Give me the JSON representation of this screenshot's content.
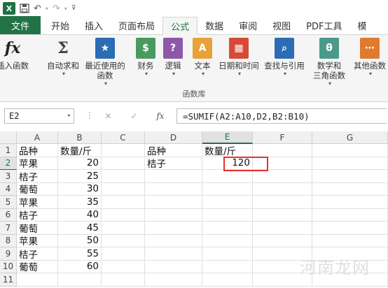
{
  "app": {
    "logo_text": "X",
    "logo_color": "#1e7145",
    "accent": "#217346"
  },
  "tabs": [
    {
      "label": "文件",
      "kind": "file"
    },
    {
      "label": "开始",
      "kind": "normal"
    },
    {
      "label": "插入",
      "kind": "normal"
    },
    {
      "label": "页面布局",
      "kind": "normal"
    },
    {
      "label": "公式",
      "kind": "active"
    },
    {
      "label": "数据",
      "kind": "normal"
    },
    {
      "label": "审阅",
      "kind": "normal"
    },
    {
      "label": "视图",
      "kind": "normal"
    },
    {
      "label": "PDF工具",
      "kind": "normal"
    },
    {
      "label": "模",
      "kind": "normal"
    }
  ],
  "ribbon": {
    "buttons": [
      {
        "name": "insert-function",
        "line1": "插入函数",
        "line2": "",
        "icon_text": "fx",
        "icon_color": "#f5f5f5",
        "icon_fg": "#222"
      },
      {
        "name": "autosum",
        "line1": "自动求和",
        "line2": "",
        "icon_text": "Σ",
        "icon_color": "#f5f5f5",
        "icon_fg": "#444"
      },
      {
        "name": "recent-functions",
        "line1": "最近使用的",
        "line2": "函数",
        "icon_text": "★",
        "icon_color": "#2b6cb5",
        "icon_fg": "#fff"
      },
      {
        "name": "financial",
        "line1": "财务",
        "line2": "",
        "icon_text": "$",
        "icon_color": "#4a9a5f",
        "icon_fg": "#fff"
      },
      {
        "name": "logical",
        "line1": "逻辑",
        "line2": "",
        "icon_text": "?",
        "icon_color": "#8e58a8",
        "icon_fg": "#fff"
      },
      {
        "name": "text",
        "line1": "文本",
        "line2": "",
        "icon_text": "A",
        "icon_color": "#e8a237",
        "icon_fg": "#fff"
      },
      {
        "name": "date-time",
        "line1": "日期和时间",
        "line2": "",
        "icon_text": "▦",
        "icon_color": "#d74a36",
        "icon_fg": "#fff"
      },
      {
        "name": "lookup-reference",
        "line1": "查找与引用",
        "line2": "",
        "icon_text": "⌕",
        "icon_color": "#2b6cb5",
        "icon_fg": "#fff"
      },
      {
        "name": "math-trig",
        "line1": "数学和",
        "line2": "三角函数",
        "icon_text": "θ",
        "icon_color": "#4a9a8a",
        "icon_fg": "#fff"
      },
      {
        "name": "more-functions",
        "line1": "其他函数",
        "line2": "",
        "icon_text": "⋯",
        "icon_color": "#e07a2e",
        "icon_fg": "#fff"
      }
    ],
    "group_label": "函数库"
  },
  "formula_bar": {
    "name_box": "E2",
    "cancel_glyph": "✕",
    "enter_glyph": "✓",
    "fx_glyph": "fx",
    "formula": "=SUMIF(A2:A10,D2,B2:B10)"
  },
  "sheet": {
    "columns": [
      "A",
      "B",
      "C",
      "D",
      "E",
      "F",
      "G"
    ],
    "rows": [
      "1",
      "2",
      "3",
      "4",
      "5",
      "6",
      "7",
      "8",
      "9",
      "10",
      "11"
    ],
    "selected_cell": "E2",
    "cells": [
      {
        "ref": "A1",
        "value": "品种"
      },
      {
        "ref": "B1",
        "value": "数量/斤"
      },
      {
        "ref": "A2",
        "value": "苹果"
      },
      {
        "ref": "B2",
        "value": "20"
      },
      {
        "ref": "A3",
        "value": "桔子"
      },
      {
        "ref": "B3",
        "value": "25"
      },
      {
        "ref": "A4",
        "value": "葡萄"
      },
      {
        "ref": "B4",
        "value": "30"
      },
      {
        "ref": "A5",
        "value": "苹果"
      },
      {
        "ref": "B5",
        "value": "35"
      },
      {
        "ref": "A6",
        "value": "桔子"
      },
      {
        "ref": "B6",
        "value": "40"
      },
      {
        "ref": "A7",
        "value": "葡萄"
      },
      {
        "ref": "B7",
        "value": "45"
      },
      {
        "ref": "A8",
        "value": "苹果"
      },
      {
        "ref": "B8",
        "value": "50"
      },
      {
        "ref": "A9",
        "value": "桔子"
      },
      {
        "ref": "B9",
        "value": "55"
      },
      {
        "ref": "A10",
        "value": "葡萄"
      },
      {
        "ref": "B10",
        "value": "60"
      },
      {
        "ref": "D1",
        "value": "品种"
      },
      {
        "ref": "E1",
        "value": "数量/斤"
      },
      {
        "ref": "D2",
        "value": "桔子"
      },
      {
        "ref": "E2",
        "value": "120"
      }
    ],
    "selection_color": "#e8302f"
  },
  "watermark": "河南龙网"
}
